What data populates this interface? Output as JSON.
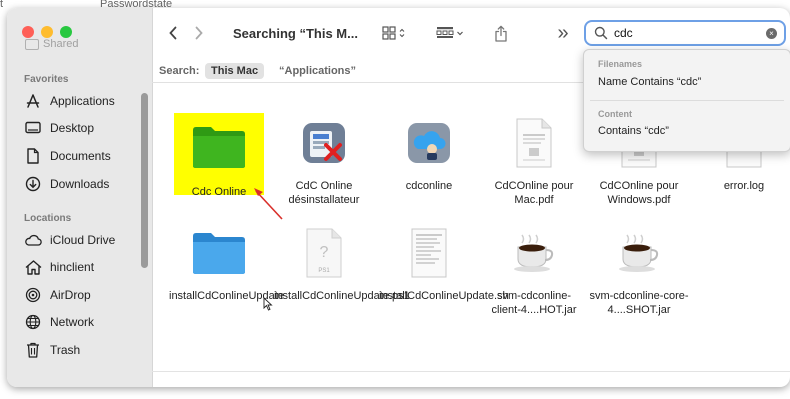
{
  "background": {
    "left_text": "t",
    "mid_text": "Passwordstate"
  },
  "sidebar": {
    "shared_label": "Shared",
    "favorites_title": "Favorites",
    "favorites": [
      {
        "label": "Applications",
        "icon": "applications-icon"
      },
      {
        "label": "Desktop",
        "icon": "desktop-icon"
      },
      {
        "label": "Documents",
        "icon": "documents-icon"
      },
      {
        "label": "Downloads",
        "icon": "downloads-icon"
      }
    ],
    "locations_title": "Locations",
    "locations": [
      {
        "label": "iCloud Drive",
        "icon": "icloud-icon"
      },
      {
        "label": "hinclient",
        "icon": "home-icon"
      },
      {
        "label": "AirDrop",
        "icon": "airdrop-icon"
      },
      {
        "label": "Network",
        "icon": "network-icon"
      },
      {
        "label": "Trash",
        "icon": "trash-icon"
      }
    ]
  },
  "toolbar": {
    "title": "Searching “This M...",
    "back_glyph": "‹",
    "forward_glyph": "›",
    "more_glyph": "»"
  },
  "search": {
    "value": "cdc",
    "clear_glyph": "×"
  },
  "scope": {
    "label": "Search:",
    "this_mac": "This Mac",
    "applications": "“Applications”"
  },
  "suggestions": {
    "filenames_header": "Filenames",
    "filenames_item": "Name Contains “cdc”",
    "content_header": "Content",
    "content_item": "Contains “cdc”"
  },
  "files": [
    {
      "name": "Cdc Online",
      "kind": "green-folder"
    },
    {
      "name": "CdC Online désinstallateur",
      "kind": "uninstaller-app"
    },
    {
      "name": "cdconline",
      "kind": "cloud-app"
    },
    {
      "name": "CdCOnline pour Mac.pdf",
      "kind": "pdf-doc"
    },
    {
      "name": "CdCOnline pour Windows.pdf",
      "kind": "pdf-doc"
    },
    {
      "name": "error.log",
      "kind": "log-doc"
    },
    {
      "name": "installCdConlineUpdate",
      "kind": "blue-folder"
    },
    {
      "name": "installCdConlineUpdate.ps1",
      "kind": "ps1-doc"
    },
    {
      "name": "installCdConlineUpdate.sh",
      "kind": "sh-doc"
    },
    {
      "name": "svm-cdconline-client-4....HOT.jar",
      "kind": "java-jar"
    },
    {
      "name": "svm-cdconline-core-4....SHOT.jar",
      "kind": "java-jar"
    }
  ],
  "annotation": {
    "highlight_color": "#ffff00",
    "arrow_color": "#d9302b"
  },
  "colors": {
    "search_focus": "#6ea0e6",
    "folder_green": "#3fb51f",
    "folder_blue": "#3b9ae0"
  }
}
